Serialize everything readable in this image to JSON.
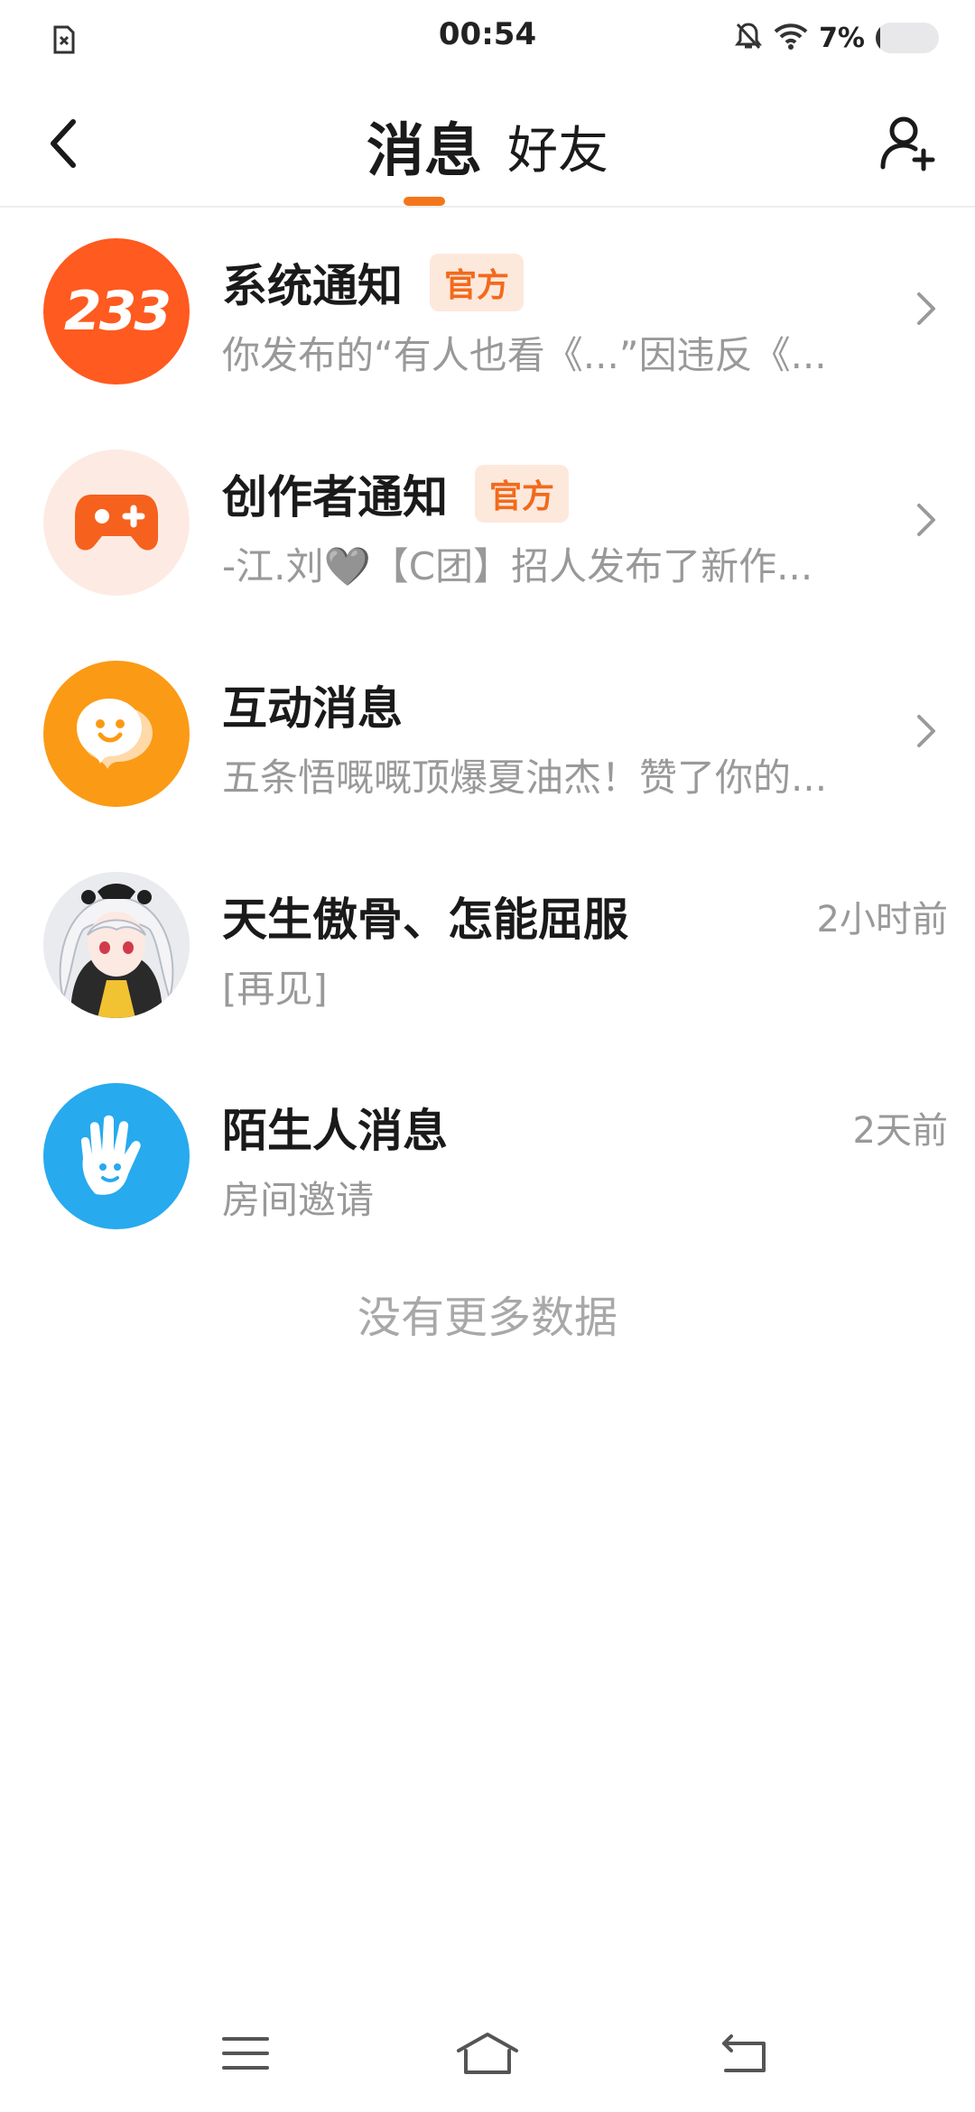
{
  "status_bar": {
    "time": "00:54",
    "battery_text": "7%",
    "battery_level": 0.07,
    "icons": [
      "sim-card-icon",
      "mute-bell-icon",
      "wifi-icon",
      "battery-icon"
    ]
  },
  "header": {
    "tabs": [
      {
        "label": "消息",
        "active": true
      },
      {
        "label": "好友",
        "active": false
      }
    ],
    "accent_color": "#f5761a"
  },
  "messages": [
    {
      "title": "系统通知",
      "badge": "官方",
      "preview": "你发布的“有人也看《...”因违反《...",
      "avatar_text": "233",
      "avatar_color": "#ff5a1f",
      "chevron": true
    },
    {
      "title": "创作者通知",
      "badge": "官方",
      "preview": "-江.刘🩶【C团】招人发布了新作...",
      "avatar_icon": "gamepad-icon",
      "avatar_color": "#fdebe3",
      "chevron": true
    },
    {
      "title": "互动消息",
      "preview": "五条悟嘅嘅顶爆夏油杰！赞了你的...",
      "avatar_icon": "chat-bubble-icon",
      "avatar_color": "#fb9a15",
      "chevron": true
    },
    {
      "title": "天生傲骨、怎能屈服",
      "preview": "[再见]",
      "time": "2小时前",
      "avatar_icon": "user-avatar"
    },
    {
      "title": "陌生人消息",
      "preview": "房间邀请",
      "time": "2天前",
      "avatar_icon": "hand-wave-icon",
      "avatar_color": "#27aaee"
    }
  ],
  "footer_text": "没有更多数据",
  "badge_colors": {
    "text": "#f26a1b",
    "background": "#fde8dc"
  },
  "nav_icons": [
    "menu-icon",
    "home-icon",
    "back-nav-icon"
  ]
}
